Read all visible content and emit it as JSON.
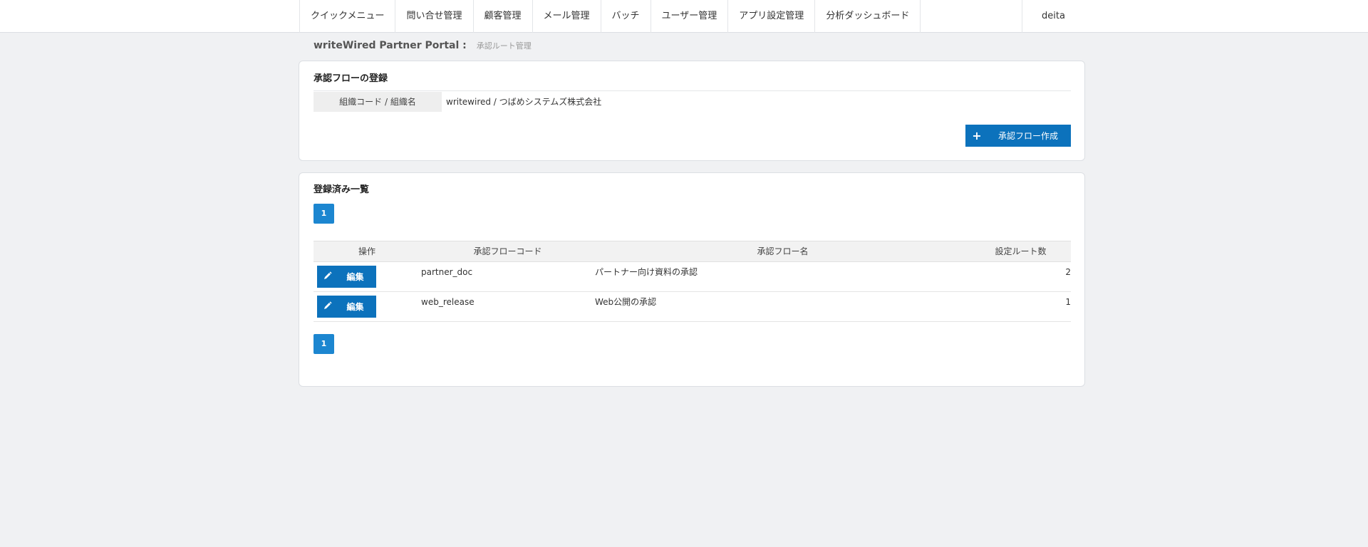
{
  "nav": {
    "items": [
      {
        "label": "クイックメニュー",
        "name": "nav-quick-menu"
      },
      {
        "label": "問い合せ管理",
        "name": "nav-inquiry-management"
      },
      {
        "label": "顧客管理",
        "name": "nav-customer-management"
      },
      {
        "label": "メール管理",
        "name": "nav-mail-management"
      },
      {
        "label": "バッチ",
        "name": "nav-batch"
      },
      {
        "label": "ユーザー管理",
        "name": "nav-user-management"
      },
      {
        "label": "アプリ設定管理",
        "name": "nav-app-settings"
      },
      {
        "label": "分析ダッシュボード",
        "name": "nav-analytics-dashboard"
      }
    ],
    "user": "deita"
  },
  "breadcrumb": {
    "portal": "writeWired Partner Portal :",
    "current": "承認ルート管理"
  },
  "register": {
    "title": "承認フローの登録",
    "org_label": "組織コード / 組織名",
    "org_value": "writewired / つばめシステムズ株式会社",
    "create_button": "承認フロー作成",
    "create_icon": "plus-icon"
  },
  "list": {
    "title": "登録済み一覧",
    "page_top": "1",
    "page_bottom": "1",
    "columns": {
      "operation": "操作",
      "code": "承認フローコード",
      "name": "承認フロー名",
      "route_count": "設定ルート数"
    },
    "rows": [
      {
        "edit_label": "編集",
        "code": "partner_doc",
        "name": "パートナー向け資料の承認",
        "route_count": "2"
      },
      {
        "edit_label": "編集",
        "code": "web_release",
        "name": "Web公開の承認",
        "route_count": "1"
      }
    ],
    "edit_icon": "pencil-icon"
  },
  "colors": {
    "primary": "#0c72bc",
    "pager": "#1c86d0",
    "background": "#f0f1f3"
  }
}
